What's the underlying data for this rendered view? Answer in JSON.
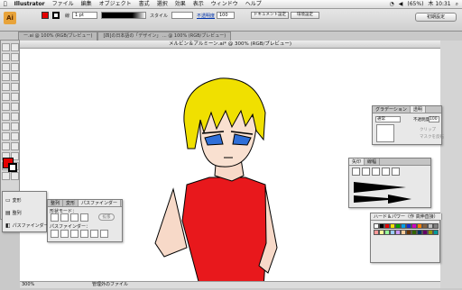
{
  "menubar": {
    "app": "Illustrator",
    "items": [
      "ファイル",
      "編集",
      "オブジェクト",
      "書式",
      "選択",
      "効果",
      "表示",
      "ウィンドウ",
      "ヘルプ"
    ],
    "battery": "(65%)",
    "clock": "木 10:31"
  },
  "control_bar": {
    "logo": "Ai",
    "stroke_label": "線",
    "stroke_value": "1 pt",
    "style_label": "スタイル",
    "opacity_label": "不透明度",
    "opacity_value": "100",
    "doc_settings_button": "ドキュメント設定",
    "env_button": "環境設定",
    "workspace_button": "初期設定"
  },
  "doc_tabs": [
    "ー.ai @ 100% (RGB/ブレビュー)",
    "[四]の日本語の「デザイン」 ... @ 100% (RGB/ブレビュー)"
  ],
  "document": {
    "title": "メルビン＆アルミーン.ai* @ 300% (RGB/プレビュー)",
    "zoom": "300%",
    "status_text": "管理外のファイル"
  },
  "colors": {
    "fill": "#e30000",
    "stroke": "#000000",
    "hair": "#f0e000",
    "eyes": "#2f6fd8",
    "shirt": "#e8181c"
  },
  "layers_panel": {
    "items": [
      "変形",
      "整列",
      "パスファインダー"
    ]
  },
  "pathfinder_panel": {
    "tabs": [
      "整列",
      "変形",
      "パスファインダー"
    ],
    "shape_mode_label": "形状モード：",
    "pathfinder_label": "パスファインダー：",
    "expand_button": "拡張"
  },
  "transparency_panel": {
    "tabs": [
      "グラデーション",
      "透明"
    ],
    "mode": "通常",
    "opacity_label": "不透明度",
    "opacity_value": "100",
    "checkbox1": "クリップ",
    "checkbox2": "マスクを反転"
  },
  "brushes_panel": {
    "tabs": [
      "矢印",
      "線幅"
    ]
  },
  "swatches_panel": {
    "tabs": [
      "ハード＆パワー（作 高伸直接）"
    ],
    "swatches": [
      "#ffffff",
      "#000000",
      "#e30000",
      "#f0e000",
      "#00a000",
      "#00a0e8",
      "#1a2bd0",
      "#d000c0",
      "#ff8000",
      "#806040",
      "#c0c0c0",
      "#808080",
      "#ff9999",
      "#ffff99",
      "#99ff99",
      "#99ccff",
      "#cc99ff",
      "#ffcc99",
      "#663300",
      "#336600",
      "#003366",
      "#660066",
      "#999900",
      "#009999"
    ]
  }
}
